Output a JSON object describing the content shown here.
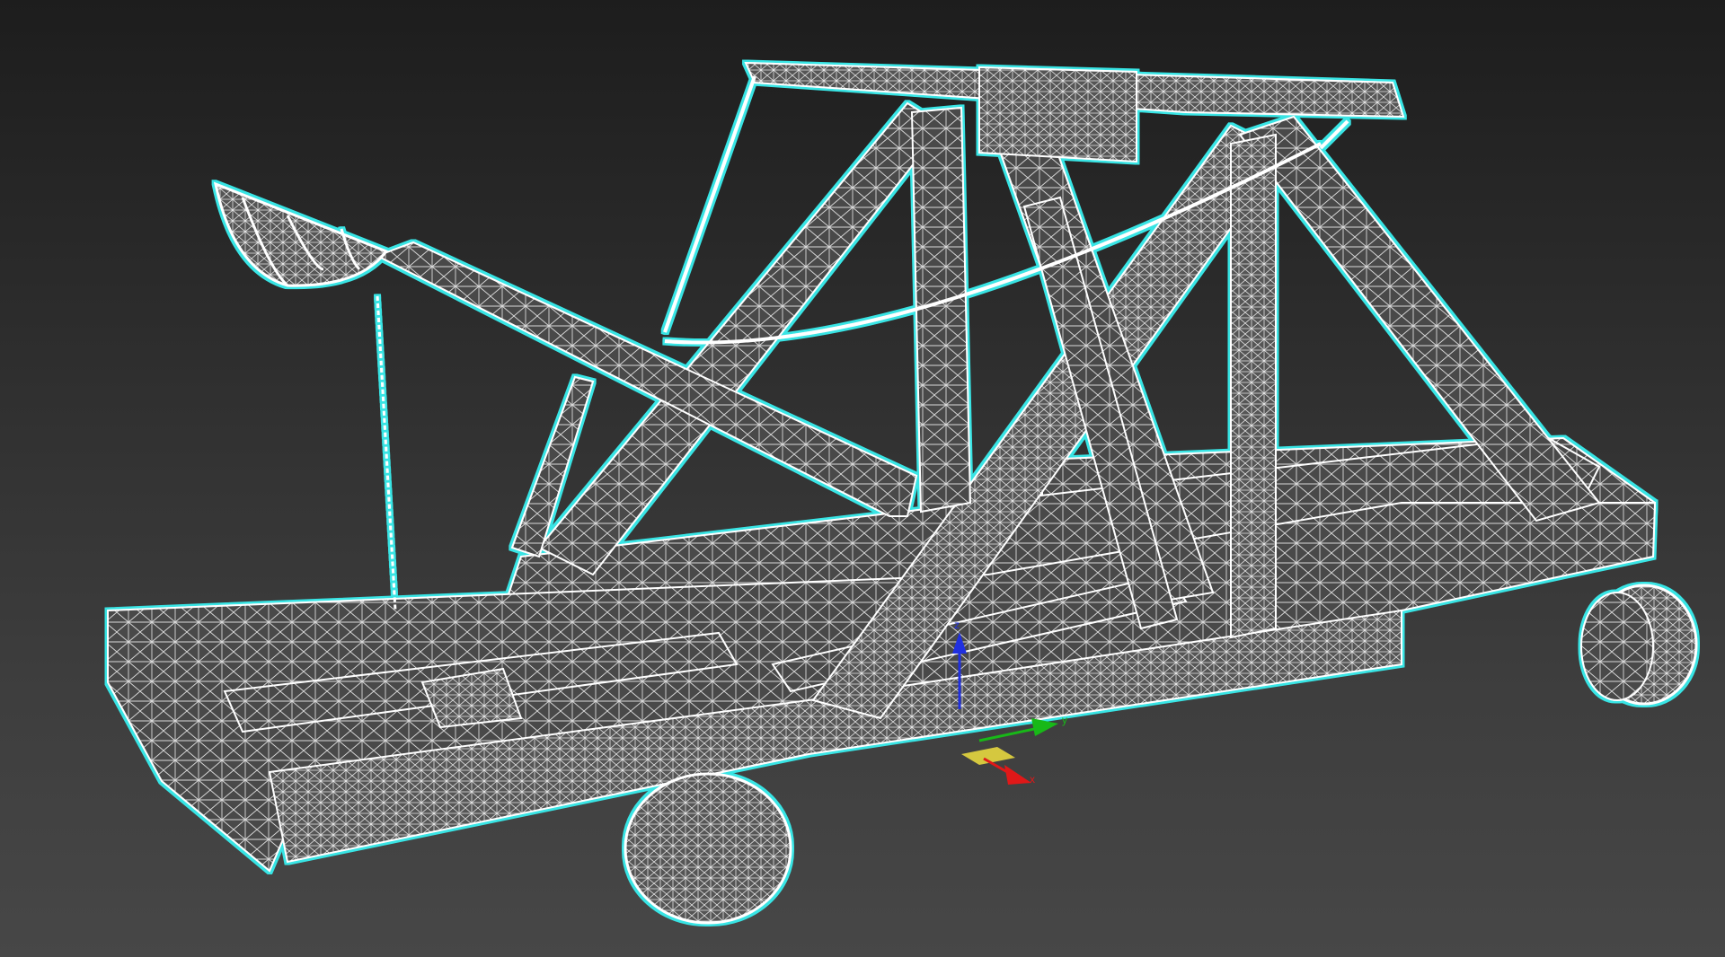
{
  "viewport": {
    "model": "catapult",
    "render_mode": "wireframe",
    "selection_outline_color": "#38e4e4",
    "wire_color": "#f2f2f2",
    "shade_color": "#4a4a4a",
    "background_top": "#1d1d1d",
    "background_bottom": "#474747"
  },
  "gizmo": {
    "icon": "transform-axis-gizmo-icon",
    "axes": [
      {
        "key": "x",
        "label": "x",
        "color": "#e01818"
      },
      {
        "key": "y",
        "label": "y",
        "color": "#18b818"
      },
      {
        "key": "z",
        "label": "z",
        "color": "#2030e0"
      }
    ],
    "plane_color": "#f0e040"
  }
}
